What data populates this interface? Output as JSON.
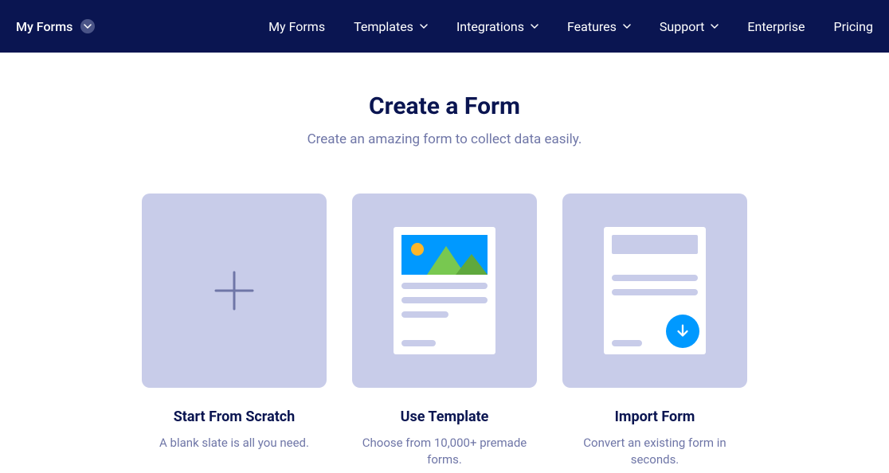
{
  "navbar": {
    "left_label": "My Forms",
    "items": [
      {
        "label": "My Forms",
        "has_dropdown": false
      },
      {
        "label": "Templates",
        "has_dropdown": true
      },
      {
        "label": "Integrations",
        "has_dropdown": true
      },
      {
        "label": "Features",
        "has_dropdown": true
      },
      {
        "label": "Support",
        "has_dropdown": true
      },
      {
        "label": "Enterprise",
        "has_dropdown": false
      },
      {
        "label": "Pricing",
        "has_dropdown": false
      }
    ]
  },
  "main": {
    "title": "Create a Form",
    "subtitle": "Create an amazing form to collect data easily."
  },
  "cards": [
    {
      "title": "Start From Scratch",
      "desc": "A blank slate is all you need."
    },
    {
      "title": "Use Template",
      "desc": "Choose from 10,000+ premade forms."
    },
    {
      "title": "Import Form",
      "desc": "Convert an existing form in seconds."
    }
  ]
}
